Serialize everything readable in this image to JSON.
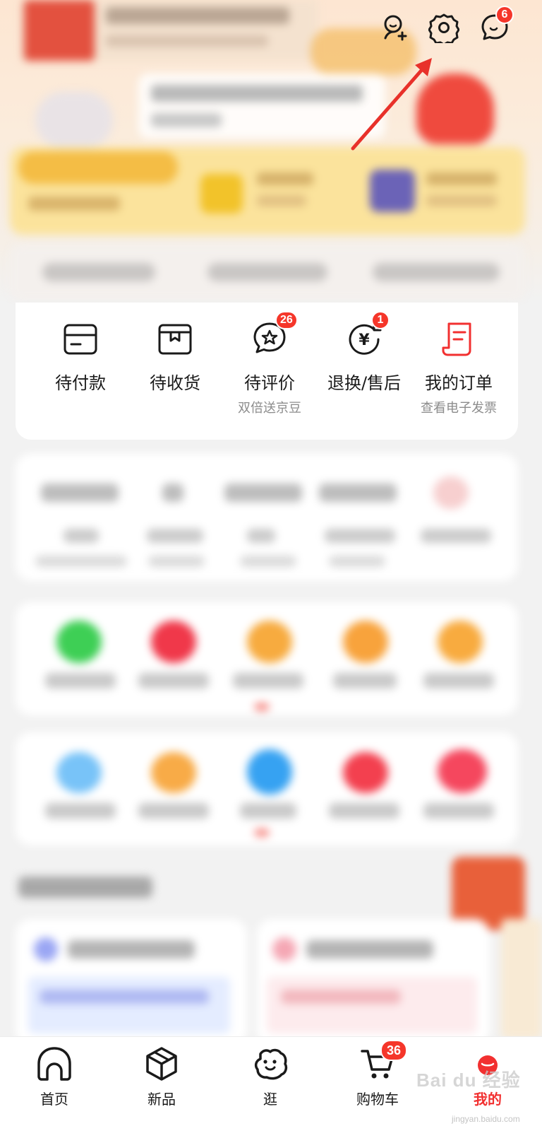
{
  "header": {
    "message_badge": "6"
  },
  "orders": {
    "items": [
      {
        "label": "待付款",
        "sub": "",
        "icon": "wallet-card-icon",
        "badge": ""
      },
      {
        "label": "待收货",
        "sub": "",
        "icon": "package-box-icon",
        "badge": ""
      },
      {
        "label": "待评价",
        "sub": "双倍送京豆",
        "icon": "review-bubble-icon",
        "badge": "26"
      },
      {
        "label": "退换/售后",
        "sub": "",
        "icon": "yen-return-icon",
        "badge": "1"
      },
      {
        "label": "我的订单",
        "sub": "查看电子发票",
        "icon": "order-list-icon",
        "badge": ""
      }
    ]
  },
  "bottom_nav": {
    "items": [
      {
        "label": "首页",
        "icon": "home-icon"
      },
      {
        "label": "新品",
        "icon": "cube-icon"
      },
      {
        "label": "逛",
        "icon": "browse-face-icon"
      },
      {
        "label": "购物车",
        "icon": "cart-icon",
        "badge": "36"
      },
      {
        "label": "我的",
        "icon": "profile-icon",
        "active": true
      }
    ]
  },
  "watermark": {
    "text": "Bai du 经验",
    "sub": "jingyan.baidu.com"
  },
  "colors": {
    "accent_red": "#f23030",
    "badge_red": "#f5362a",
    "arrow_red": "#e8312a"
  }
}
